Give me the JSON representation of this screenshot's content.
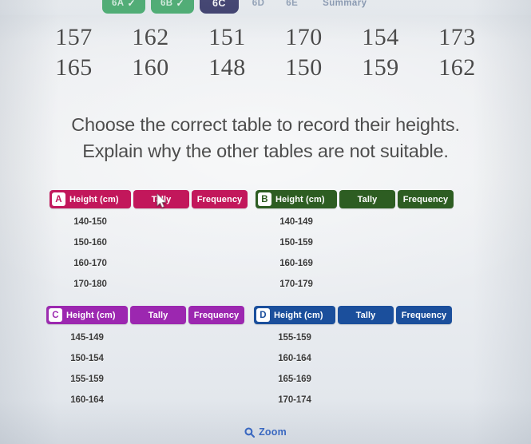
{
  "nav": {
    "tabs": [
      {
        "label": "6A",
        "state": "done",
        "tick": "✓"
      },
      {
        "label": "6B",
        "state": "done",
        "tick": "✓"
      },
      {
        "label": "6C",
        "state": "active"
      },
      {
        "label": "6D",
        "state": "plain"
      },
      {
        "label": "6E",
        "state": "plain"
      },
      {
        "label": "Summary",
        "state": "plain"
      }
    ],
    "colors": {
      "done_bg": "#4caf72",
      "active_bg": "#3e3f6e",
      "plain_text": "#93a2b8"
    }
  },
  "data_values": {
    "row1": [
      "157",
      "162",
      "151",
      "170",
      "154",
      "173"
    ],
    "row2": [
      "165",
      "160",
      "148",
      "150",
      "159",
      "162"
    ]
  },
  "prompt": {
    "line1": "Choose the correct table to record their heights.",
    "line2": "Explain why the other tables are not suitable."
  },
  "columns": {
    "height": "Height (cm)",
    "tally": "Tally",
    "frequency": "Frequency"
  },
  "tables": [
    {
      "id": "A",
      "accent": "#c2175b",
      "rows": [
        "140-150",
        "150-160",
        "160-170",
        "170-180"
      ]
    },
    {
      "id": "B",
      "accent": "#2d5d22",
      "rows": [
        "140-149",
        "150-159",
        "160-169",
        "170-179"
      ]
    },
    {
      "id": "C",
      "accent": "#9c27b0",
      "rows": [
        "145-149",
        "150-154",
        "155-159",
        "160-164"
      ]
    },
    {
      "id": "D",
      "accent": "#1b4f9c",
      "rows": [
        "155-159",
        "160-164",
        "165-169",
        "170-174"
      ]
    }
  ],
  "footer": {
    "zoom_label": "Zoom",
    "zoom_icon": "magnifier-icon",
    "zoom_color": "#2f62c4"
  }
}
